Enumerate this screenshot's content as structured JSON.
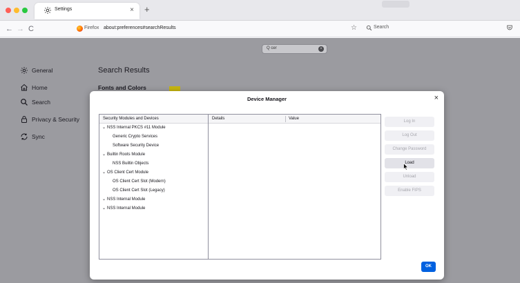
{
  "tab": {
    "title": "Settings",
    "close": "×",
    "new_tab": "+"
  },
  "nav": {
    "back": "←",
    "forward": "→",
    "reload": "C"
  },
  "urlbar": {
    "brand": "Firefox",
    "url": "about:preferences#searchResults"
  },
  "search": {
    "placeholder": "Search"
  },
  "prefs": {
    "search_value": "cer",
    "categories": [
      {
        "label": "General",
        "icon": "gear-icon"
      },
      {
        "label": "Home",
        "icon": "home-icon"
      },
      {
        "label": "Search",
        "icon": "search-icon"
      },
      {
        "label": "Privacy & Security",
        "icon": "lock-icon"
      },
      {
        "label": "Sync",
        "icon": "sync-icon"
      }
    ],
    "results_title": "Search Results",
    "fonts_title": "Fonts and Colors"
  },
  "dialog": {
    "title": "Device Manager",
    "close": "×",
    "tree_header": "Security Modules and Devices",
    "tree": [
      {
        "label": "NSS Internal PKCS #11 Module",
        "level": 0,
        "expanded": true
      },
      {
        "label": "Generic Crypto Services",
        "level": 1
      },
      {
        "label": "Software Security Device",
        "level": 1
      },
      {
        "label": "Builtin Roots Module",
        "level": 0,
        "expanded": true
      },
      {
        "label": "NSS Builtin Objects",
        "level": 1
      },
      {
        "label": "OS Client Cert Module",
        "level": 0,
        "expanded": true
      },
      {
        "label": "OS Client Cert Slot (Modern)",
        "level": 1
      },
      {
        "label": "OS Client Cert Slot (Legacy)",
        "level": 1
      },
      {
        "label": "NSS Internal Module",
        "level": 0,
        "expanded": true
      },
      {
        "label": "NSS Internal Module",
        "level": 0,
        "expanded": true
      }
    ],
    "details_header": "Details",
    "value_header": "Value",
    "buttons": {
      "log_in": "Log In",
      "log_out": "Log Out",
      "change_password": "Change Password",
      "load": "Load",
      "unload": "Unload",
      "enable_fips": "Enable FIPS"
    },
    "ok": "OK",
    "twisty": "⌄"
  },
  "colors": {
    "accent": "#0061e0",
    "highlight": "#c7b60f"
  }
}
